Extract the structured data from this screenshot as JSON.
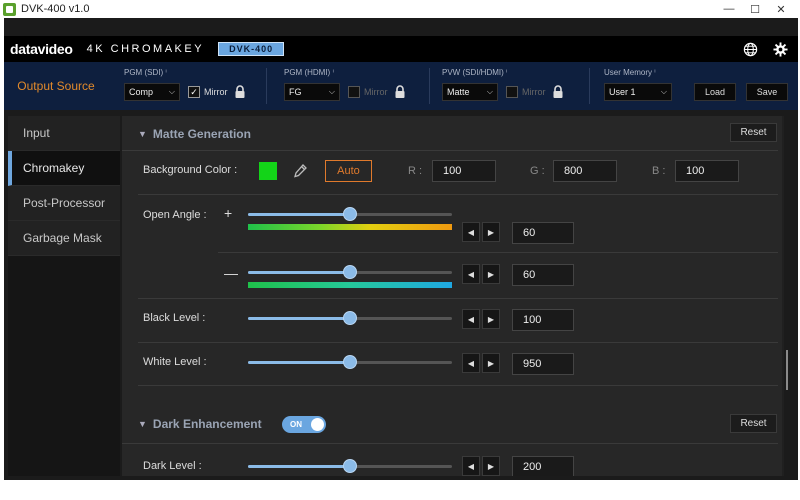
{
  "window": {
    "title": "DVK-400  v1.0",
    "minimize": "—",
    "maximize": "☐",
    "close": "✕"
  },
  "brand": {
    "logo": "datavideo",
    "product": "4K CHROMAKEY",
    "model": "DVK-400"
  },
  "output": {
    "label": "Output Source",
    "pgm_sdi": {
      "label": "PGM (SDI)",
      "value": "Comp",
      "mirror": "Mirror",
      "mirror_checked": true
    },
    "pgm_hdmi": {
      "label": "PGM (HDMI)",
      "value": "FG",
      "mirror": "Mirror",
      "mirror_checked": false
    },
    "pvw": {
      "label": "PVW (SDI/HDMI)",
      "value": "Matte",
      "mirror": "Mirror",
      "mirror_checked": false
    },
    "memory": {
      "label": "User Memory",
      "value": "User 1",
      "load": "Load",
      "save": "Save"
    },
    "info_mark": "ⁱ"
  },
  "sidebar": {
    "items": [
      "Input",
      "Chromakey",
      "Post-Processor",
      "Garbage Mask"
    ],
    "active": 1
  },
  "matte": {
    "title": "Matte Generation",
    "reset": "Reset",
    "bg_label": "Background Color :",
    "bg_color": "#13d418",
    "auto": "Auto",
    "r_label": "R :",
    "r": "100",
    "g_label": "G :",
    "g": "800",
    "b_label": "B :",
    "b": "100",
    "open_angle_label": "Open Angle :",
    "plus": "+",
    "minus": "—",
    "open_plus": "60",
    "open_minus": "60",
    "black_label": "Black Level :",
    "black": "100",
    "white_label": "White Level :",
    "white": "950",
    "slider_fraction": 0.5
  },
  "dark": {
    "title": "Dark Enhancement",
    "toggle": "ON",
    "reset": "Reset",
    "level_label": "Dark Level :",
    "level": "200"
  },
  "colors": {
    "accent": "#6fa7df",
    "orange": "#e07a2c",
    "navy": "#0e1f3e"
  }
}
